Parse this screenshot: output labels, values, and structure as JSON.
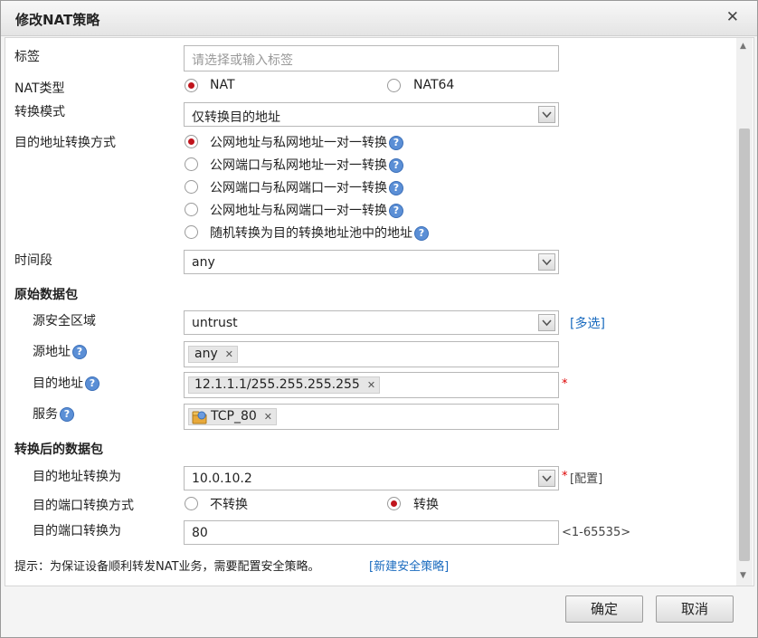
{
  "dialog": {
    "title": "修改NAT策略",
    "close_glyph": "✕"
  },
  "fields": {
    "tag": {
      "label": "标签",
      "placeholder": "请选择或输入标签"
    },
    "nat_type": {
      "label": "NAT类型",
      "options": [
        "NAT",
        "NAT64"
      ],
      "selected": "NAT"
    },
    "mode": {
      "label": "转换模式",
      "value": "仅转换目的地址"
    },
    "dst_method": {
      "label": "目的地址转换方式",
      "options": [
        "公网地址与私网地址一对一转换",
        "公网端口与私网地址一对一转换",
        "公网端口与私网端口一对一转换",
        "公网地址与私网端口一对一转换",
        "随机转换为目的转换地址池中的地址"
      ],
      "selected": "公网地址与私网地址一对一转换"
    },
    "time": {
      "label": "时间段",
      "value": "any"
    }
  },
  "original": {
    "section": "原始数据包",
    "src_zone": {
      "label": "源安全区域",
      "value": "untrust",
      "multi_link": "[多选]"
    },
    "src_addr": {
      "label": "源地址",
      "tag": "any"
    },
    "dst_addr": {
      "label": "目的地址",
      "tag": "12.1.1.1/255.255.255.255",
      "required": "*"
    },
    "service": {
      "label": "服务",
      "tag": "TCP_80"
    }
  },
  "translated": {
    "section": "转换后的数据包",
    "dst_addr": {
      "label": "目的地址转换为",
      "value": "10.0.10.2",
      "required": "*",
      "config_link": "[配置]"
    },
    "port_method": {
      "label": "目的端口转换方式",
      "options": [
        "不转换",
        "转换"
      ],
      "selected": "转换"
    },
    "port": {
      "label": "目的端口转换为",
      "value": "80",
      "range": "<1-65535>"
    }
  },
  "tip": {
    "text": "提示：为保证设备顺利转发NAT业务，需要配置安全策略。",
    "link": "[新建安全策略]"
  },
  "buttons": {
    "ok": "确定",
    "cancel": "取消"
  },
  "help_glyph": "?",
  "tag_close_glyph": "✕",
  "colors": {
    "radio_selected": "#c0141c",
    "link": "#1a6bbf",
    "required": "#d00000"
  }
}
